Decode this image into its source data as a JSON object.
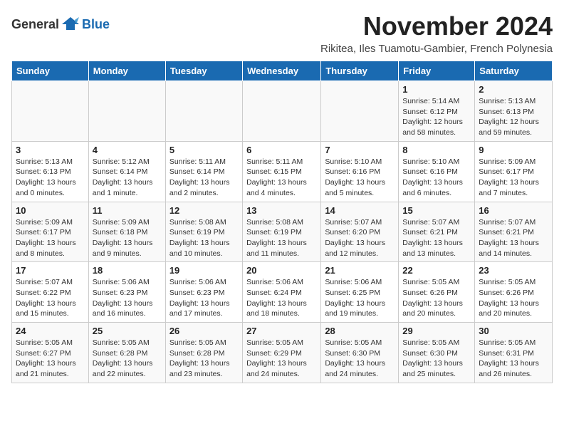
{
  "logo": {
    "general": "General",
    "blue": "Blue"
  },
  "title": "November 2024",
  "subtitle": "Rikitea, Iles Tuamotu-Gambier, French Polynesia",
  "weekdays": [
    "Sunday",
    "Monday",
    "Tuesday",
    "Wednesday",
    "Thursday",
    "Friday",
    "Saturday"
  ],
  "weeks": [
    [
      {
        "day": "",
        "info": ""
      },
      {
        "day": "",
        "info": ""
      },
      {
        "day": "",
        "info": ""
      },
      {
        "day": "",
        "info": ""
      },
      {
        "day": "",
        "info": ""
      },
      {
        "day": "1",
        "info": "Sunrise: 5:14 AM\nSunset: 6:12 PM\nDaylight: 12 hours and 58 minutes."
      },
      {
        "day": "2",
        "info": "Sunrise: 5:13 AM\nSunset: 6:13 PM\nDaylight: 12 hours and 59 minutes."
      }
    ],
    [
      {
        "day": "3",
        "info": "Sunrise: 5:13 AM\nSunset: 6:13 PM\nDaylight: 13 hours and 0 minutes."
      },
      {
        "day": "4",
        "info": "Sunrise: 5:12 AM\nSunset: 6:14 PM\nDaylight: 13 hours and 1 minute."
      },
      {
        "day": "5",
        "info": "Sunrise: 5:11 AM\nSunset: 6:14 PM\nDaylight: 13 hours and 2 minutes."
      },
      {
        "day": "6",
        "info": "Sunrise: 5:11 AM\nSunset: 6:15 PM\nDaylight: 13 hours and 4 minutes."
      },
      {
        "day": "7",
        "info": "Sunrise: 5:10 AM\nSunset: 6:16 PM\nDaylight: 13 hours and 5 minutes."
      },
      {
        "day": "8",
        "info": "Sunrise: 5:10 AM\nSunset: 6:16 PM\nDaylight: 13 hours and 6 minutes."
      },
      {
        "day": "9",
        "info": "Sunrise: 5:09 AM\nSunset: 6:17 PM\nDaylight: 13 hours and 7 minutes."
      }
    ],
    [
      {
        "day": "10",
        "info": "Sunrise: 5:09 AM\nSunset: 6:17 PM\nDaylight: 13 hours and 8 minutes."
      },
      {
        "day": "11",
        "info": "Sunrise: 5:09 AM\nSunset: 6:18 PM\nDaylight: 13 hours and 9 minutes."
      },
      {
        "day": "12",
        "info": "Sunrise: 5:08 AM\nSunset: 6:19 PM\nDaylight: 13 hours and 10 minutes."
      },
      {
        "day": "13",
        "info": "Sunrise: 5:08 AM\nSunset: 6:19 PM\nDaylight: 13 hours and 11 minutes."
      },
      {
        "day": "14",
        "info": "Sunrise: 5:07 AM\nSunset: 6:20 PM\nDaylight: 13 hours and 12 minutes."
      },
      {
        "day": "15",
        "info": "Sunrise: 5:07 AM\nSunset: 6:21 PM\nDaylight: 13 hours and 13 minutes."
      },
      {
        "day": "16",
        "info": "Sunrise: 5:07 AM\nSunset: 6:21 PM\nDaylight: 13 hours and 14 minutes."
      }
    ],
    [
      {
        "day": "17",
        "info": "Sunrise: 5:07 AM\nSunset: 6:22 PM\nDaylight: 13 hours and 15 minutes."
      },
      {
        "day": "18",
        "info": "Sunrise: 5:06 AM\nSunset: 6:23 PM\nDaylight: 13 hours and 16 minutes."
      },
      {
        "day": "19",
        "info": "Sunrise: 5:06 AM\nSunset: 6:23 PM\nDaylight: 13 hours and 17 minutes."
      },
      {
        "day": "20",
        "info": "Sunrise: 5:06 AM\nSunset: 6:24 PM\nDaylight: 13 hours and 18 minutes."
      },
      {
        "day": "21",
        "info": "Sunrise: 5:06 AM\nSunset: 6:25 PM\nDaylight: 13 hours and 19 minutes."
      },
      {
        "day": "22",
        "info": "Sunrise: 5:05 AM\nSunset: 6:26 PM\nDaylight: 13 hours and 20 minutes."
      },
      {
        "day": "23",
        "info": "Sunrise: 5:05 AM\nSunset: 6:26 PM\nDaylight: 13 hours and 20 minutes."
      }
    ],
    [
      {
        "day": "24",
        "info": "Sunrise: 5:05 AM\nSunset: 6:27 PM\nDaylight: 13 hours and 21 minutes."
      },
      {
        "day": "25",
        "info": "Sunrise: 5:05 AM\nSunset: 6:28 PM\nDaylight: 13 hours and 22 minutes."
      },
      {
        "day": "26",
        "info": "Sunrise: 5:05 AM\nSunset: 6:28 PM\nDaylight: 13 hours and 23 minutes."
      },
      {
        "day": "27",
        "info": "Sunrise: 5:05 AM\nSunset: 6:29 PM\nDaylight: 13 hours and 24 minutes."
      },
      {
        "day": "28",
        "info": "Sunrise: 5:05 AM\nSunset: 6:30 PM\nDaylight: 13 hours and 24 minutes."
      },
      {
        "day": "29",
        "info": "Sunrise: 5:05 AM\nSunset: 6:30 PM\nDaylight: 13 hours and 25 minutes."
      },
      {
        "day": "30",
        "info": "Sunrise: 5:05 AM\nSunset: 6:31 PM\nDaylight: 13 hours and 26 minutes."
      }
    ]
  ]
}
